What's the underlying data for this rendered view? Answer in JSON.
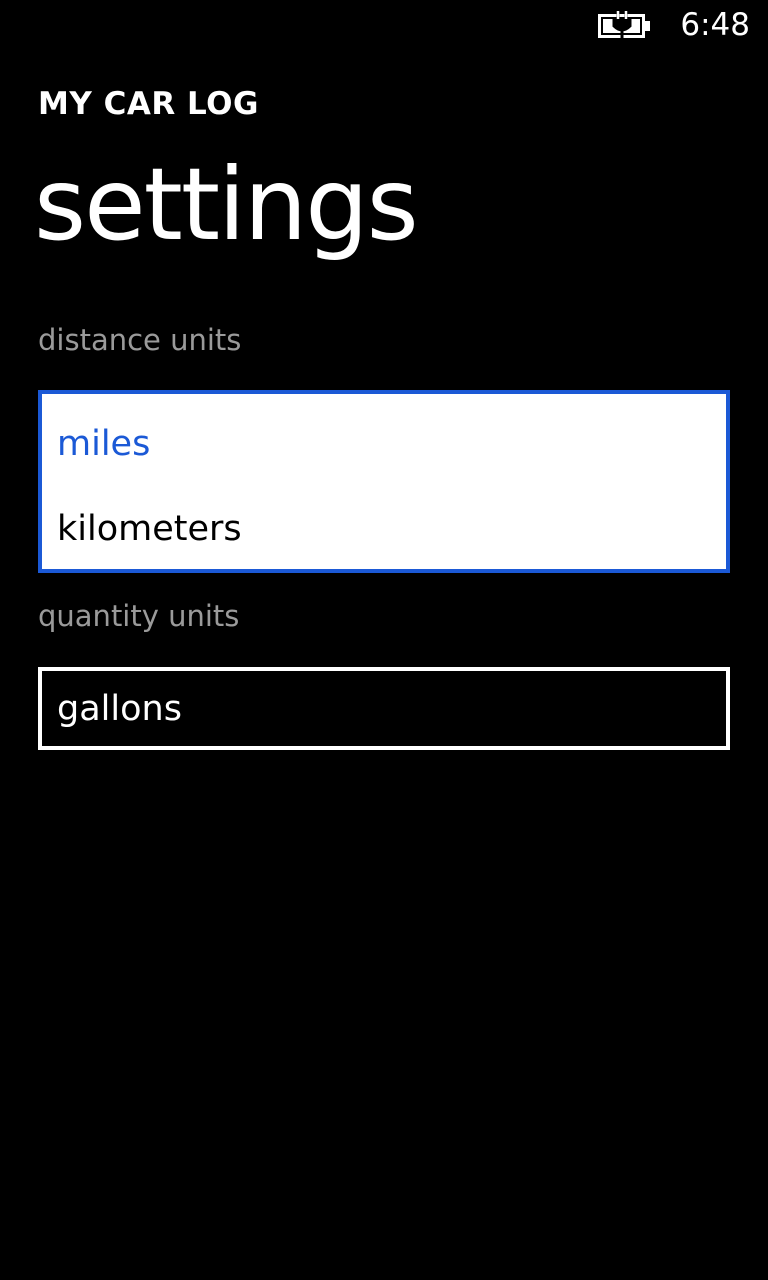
{
  "status_bar": {
    "time": "6:48",
    "battery_icon": "battery-charging-icon"
  },
  "header": {
    "app_title": "MY CAR LOG",
    "page_title": "settings"
  },
  "settings": {
    "distance_units": {
      "label": "distance units",
      "options": [
        {
          "label": "miles",
          "selected": true
        },
        {
          "label": "kilometers",
          "selected": false
        }
      ],
      "expanded": true
    },
    "quantity_units": {
      "label": "quantity units",
      "value": "gallons",
      "expanded": false
    }
  },
  "colors": {
    "background": "#000000",
    "accent": "#1b59d6",
    "label_gray": "#9a9a9a",
    "text": "#ffffff",
    "option_text": "#000000"
  }
}
